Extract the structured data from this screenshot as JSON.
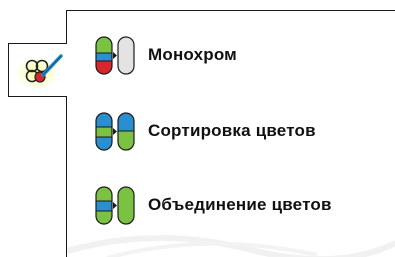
{
  "tool_button": {
    "icon": "color-options-icon"
  },
  "menu": {
    "items": [
      {
        "label": "Монохром",
        "icon": "monochrome-icon"
      },
      {
        "label": "Сортировка цветов",
        "icon": "color-sort-icon"
      },
      {
        "label": "Объединение цветов",
        "icon": "color-merge-icon"
      }
    ]
  },
  "colors": {
    "green": "#7cc242",
    "blue": "#2a8fd0",
    "red": "#d8262d",
    "gray": "#e3e3e3",
    "outline": "#1a1a1a"
  }
}
